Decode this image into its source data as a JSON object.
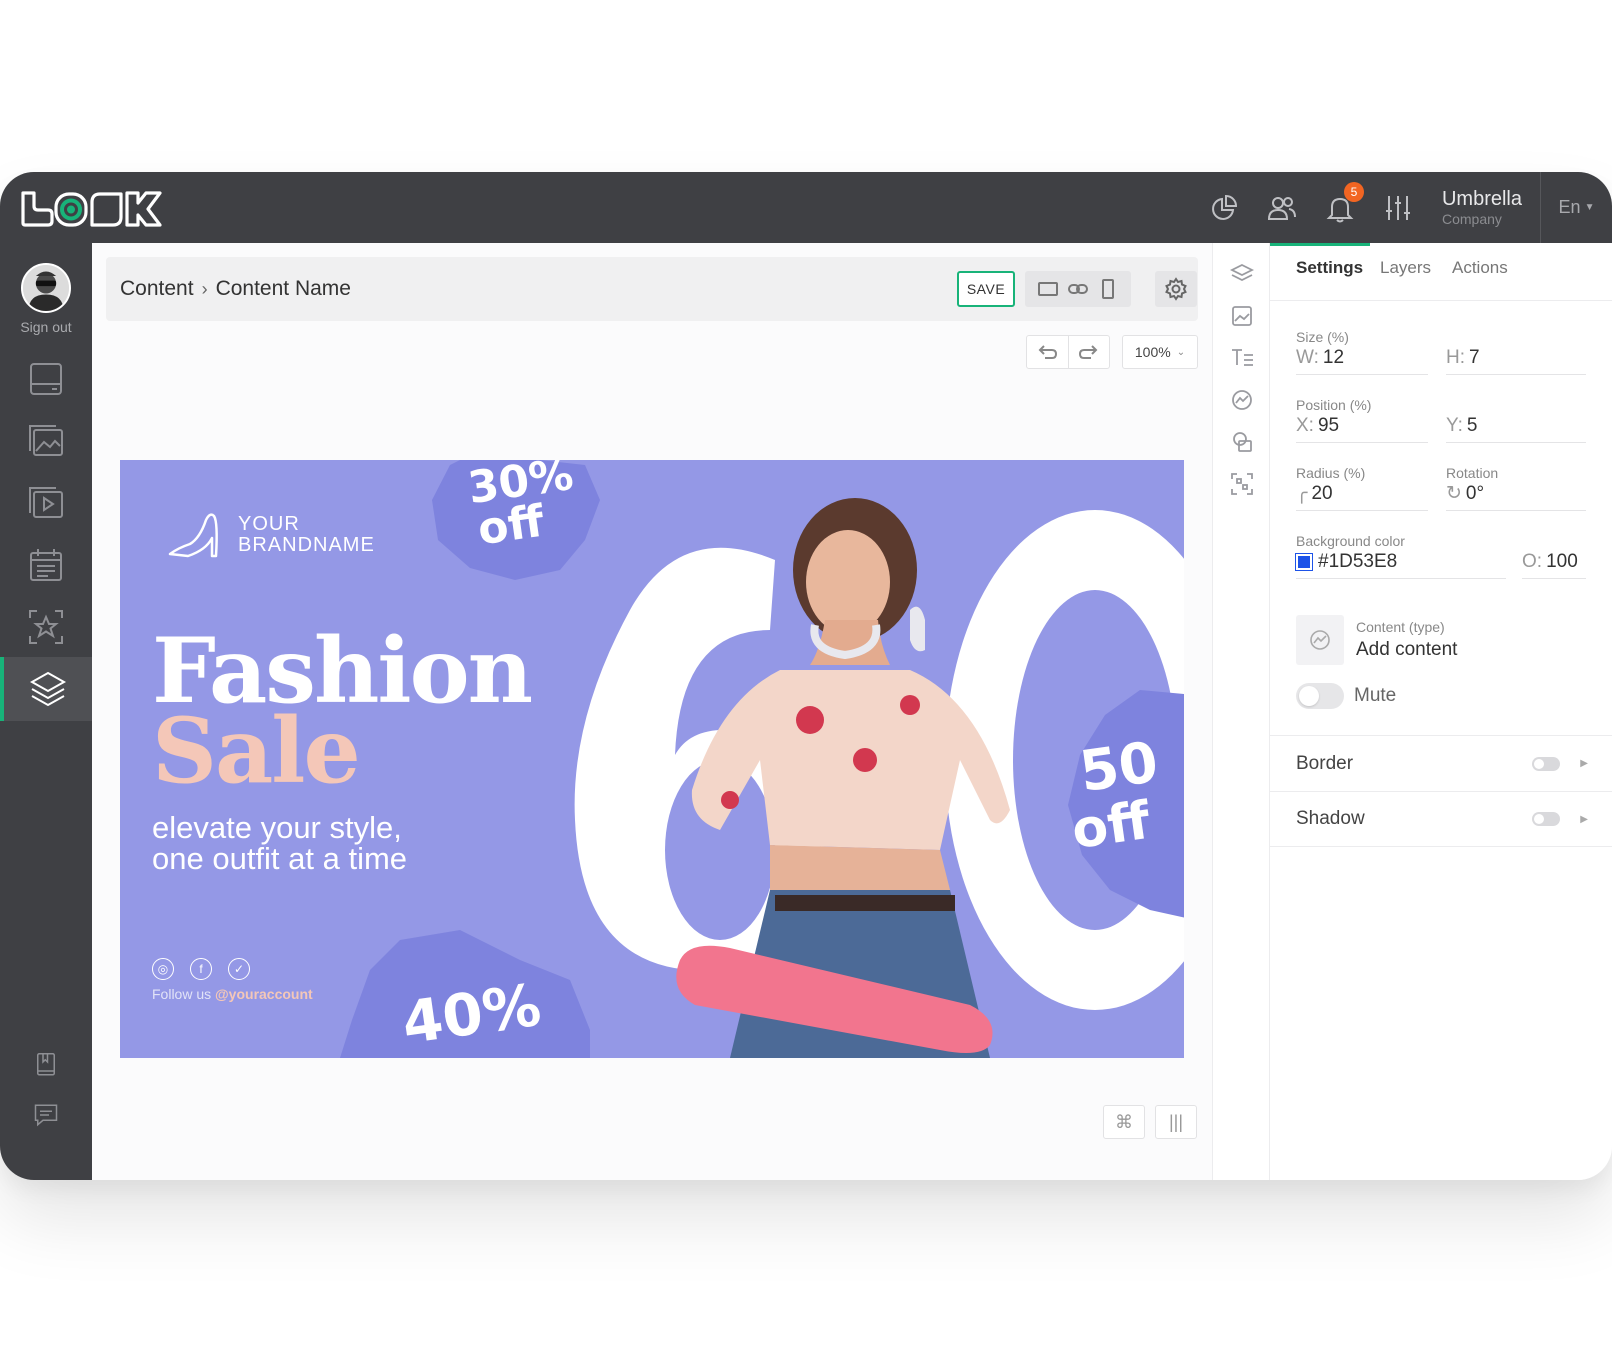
{
  "app": {
    "company_name": "Umbrella",
    "company_sub": "Company",
    "language": "En",
    "notification_count": "5",
    "accent_color": "#18b379"
  },
  "sidebar": {
    "sign_out": "Sign out",
    "items": [
      {
        "icon": "screen-icon"
      },
      {
        "icon": "image-icon"
      },
      {
        "icon": "video-icon"
      },
      {
        "icon": "calendar-icon"
      },
      {
        "icon": "star-frame-icon"
      },
      {
        "icon": "layers-icon",
        "active": true
      },
      {
        "icon": "book-icon"
      },
      {
        "icon": "chat-icon"
      }
    ]
  },
  "toolbar": {
    "breadcrumb_root": "Content",
    "breadcrumb_separator": "›",
    "breadcrumb_current": "Content Name",
    "save_label": "SAVE",
    "zoom": "100%"
  },
  "banner": {
    "brand_line1": "YOUR",
    "brand_line2": "BRANDNAME",
    "headline1": "Fashion",
    "headline2": "Sale",
    "tagline1": "elevate your style,",
    "tagline2": "one outfit at a time",
    "follow_prefix": "Follow us ",
    "follow_handle": "@youraccount",
    "badge_30_a": "30%",
    "badge_30_b": "off",
    "badge_50_a": "50",
    "badge_50_b": "off",
    "badge_40": "40%",
    "big_number": "60",
    "bg_color": "#9498e6"
  },
  "panel": {
    "tabs": [
      "Settings",
      "Layers",
      "Actions"
    ],
    "size_label": "Size (%)",
    "w_prefix": "W:",
    "w_value": "12",
    "h_prefix": "H:",
    "h_value": "7",
    "position_label": "Position (%)",
    "x_prefix": "X:",
    "x_value": "95",
    "y_prefix": "Y:",
    "y_value": "5",
    "radius_label": "Radius (%)",
    "radius_value": "20",
    "rotation_label": "Rotation",
    "rotation_value": "0°",
    "bgcolor_label": "Background color",
    "bgcolor_value": "#1D53E8",
    "opacity_prefix": "O:",
    "opacity_value": "100",
    "content_type_label": "Content (type)",
    "content_type_value": "Add content",
    "mute_label": "Mute",
    "border_label": "Border",
    "shadow_label": "Shadow"
  },
  "bottom_buttons": [
    "⌘",
    "|||"
  ]
}
